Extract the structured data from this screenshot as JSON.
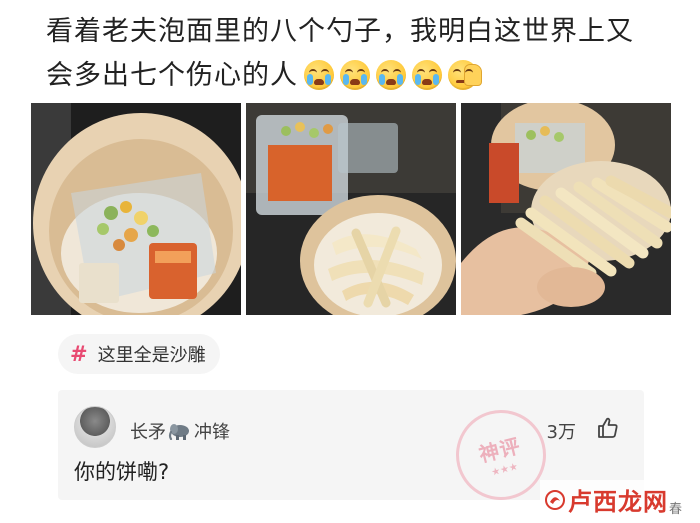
{
  "post": {
    "line1": "看着老夫泡面里的八个勺子，我明白这世界上又",
    "line2": "会多出七个伤心的人",
    "emojis": [
      "crying-face-icon",
      "crying-face-icon",
      "crying-face-icon",
      "crying-face-icon",
      "facepalm-icon"
    ]
  },
  "photos": [
    {
      "icon": "instant-noodle-cup-photo"
    },
    {
      "icon": "noodle-cup-with-spoons-photo"
    },
    {
      "icon": "hand-holding-spoons-photo"
    }
  ],
  "topic": {
    "hash": "#",
    "label": "这里全是沙雕"
  },
  "comment": {
    "user_part1": "长矛",
    "user_part2": "冲锋",
    "user_icon": "elephant-icon",
    "likes": "3万",
    "body": "你的饼嘞?",
    "stamp": "神评",
    "stamp_stars": "★★★"
  },
  "watermark": {
    "text": "卢西龙网",
    "suffix": "春"
  },
  "colors": {
    "accent": "#e84a72",
    "chip_bg": "#f5f5f5",
    "watermark_red": "#d83a2e"
  }
}
